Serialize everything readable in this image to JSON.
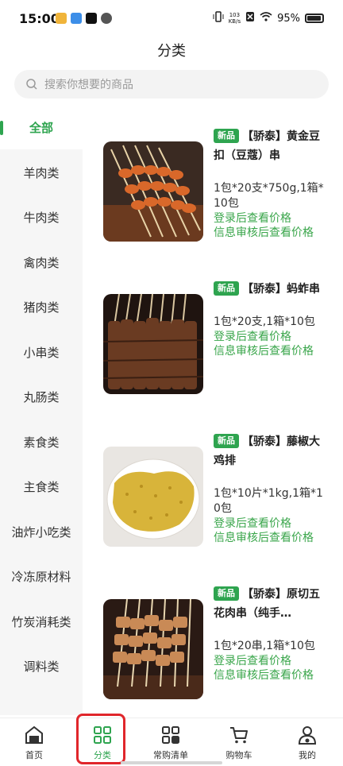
{
  "status": {
    "time": "15:00",
    "net_speed_top": "103",
    "net_speed_bottom": "KB/s",
    "battery": "95%"
  },
  "header": {
    "title": "分类"
  },
  "search": {
    "placeholder": "搜索你想要的商品"
  },
  "sidebar": {
    "items": [
      {
        "label": "全部"
      },
      {
        "label": "羊肉类"
      },
      {
        "label": "牛肉类"
      },
      {
        "label": "禽肉类"
      },
      {
        "label": "猪肉类"
      },
      {
        "label": "小串类"
      },
      {
        "label": "丸肠类"
      },
      {
        "label": "素食类"
      },
      {
        "label": "主食类"
      },
      {
        "label": "油炸小吃类"
      },
      {
        "label": "冷冻原材料"
      },
      {
        "label": "竹炭消耗类"
      },
      {
        "label": "调料类"
      }
    ]
  },
  "products": [
    {
      "tag": "新品",
      "title": "【骄泰】黄金豆扣（豆蔻）串",
      "spec": "1包*20支*750g,1箱*10包",
      "price_login": "登录后查看价格",
      "price_review": "信息审核后查看价格"
    },
    {
      "tag": "新品",
      "title": "【骄泰】蚂蚱串",
      "spec": "1包*20支,1箱*10包",
      "price_login": "登录后查看价格",
      "price_review": "信息审核后查看价格"
    },
    {
      "tag": "新品",
      "title": "【骄泰】藤椒大鸡排",
      "spec": "1包*10片*1kg,1箱*10包",
      "price_login": "登录后查看价格",
      "price_review": "信息审核后查看价格"
    },
    {
      "tag": "新品",
      "title": "【骄泰】原切五花肉串（纯手…",
      "spec": "1包*20串,1箱*10包",
      "price_login": "登录后查看价格",
      "price_review": "信息审核后查看价格"
    }
  ],
  "nav": {
    "items": [
      {
        "label": "首页",
        "icon": "home-icon"
      },
      {
        "label": "分类",
        "icon": "category-grid-icon"
      },
      {
        "label": "常购清单",
        "icon": "list-grid-icon"
      },
      {
        "label": "购物车",
        "icon": "cart-icon"
      },
      {
        "label": "我的",
        "icon": "user-icon"
      }
    ],
    "active": "分类"
  },
  "colors": {
    "accent": "#2ea44f",
    "price": "#3aa64b",
    "highlight_box": "#e0262b"
  }
}
